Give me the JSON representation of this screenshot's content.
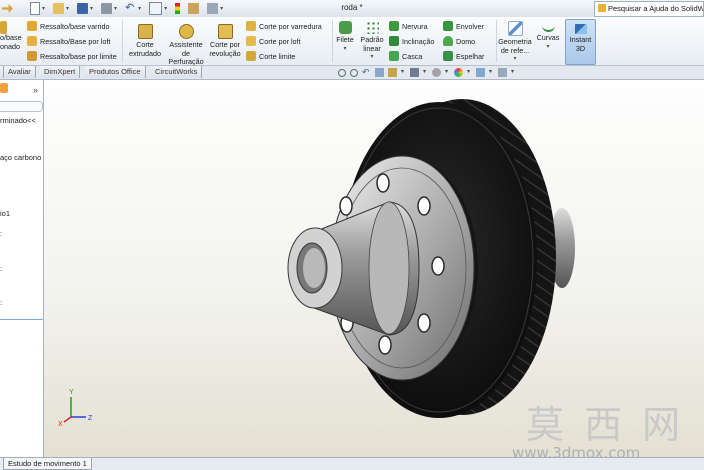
{
  "window": {
    "title": "roda *",
    "search_placeholder": "Pesquisar a Ajuda do SolidWo"
  },
  "ribbon": {
    "features_col1": [
      "Ressalto/base varrido",
      "Ressalto/Base por loft",
      "Ressalto/base por limite"
    ],
    "features_partial": [
      "o/base",
      "onado"
    ],
    "cut_extrude": "Corte extrudado",
    "hole_wizard": "Assistente de Perfuração",
    "revolve_cut": "Corte por revolução",
    "cuts_col": [
      "Corte por varredura",
      "Corte por loft",
      "Corte limite"
    ],
    "fillet": "Filete",
    "linear_pattern": "Padrão linear",
    "col_rib": [
      "Nervura",
      "Inclinação",
      "Casca"
    ],
    "col_wrap": [
      "Envolver",
      "Domo",
      "Espelhar"
    ],
    "ref_geometry": "Geometria de refe...",
    "curves": "Curvas",
    "instant3d": "Instant 3D"
  },
  "tabs": [
    "Avaliar",
    "DimXpert",
    "Produtos Office",
    "CircuitWorks"
  ],
  "tree": {
    "items": [
      "rminado<<",
      "aço carbono",
      "io1",
      ":",
      ":",
      ":"
    ],
    "collapse": "»"
  },
  "status": {
    "motion_tab": "Estudo de movimento 1"
  },
  "triad": {
    "x": "X",
    "y": "Y",
    "z": "Z"
  },
  "watermark": {
    "chinese": "莫 西 网",
    "url": "www.3dmox.com"
  }
}
